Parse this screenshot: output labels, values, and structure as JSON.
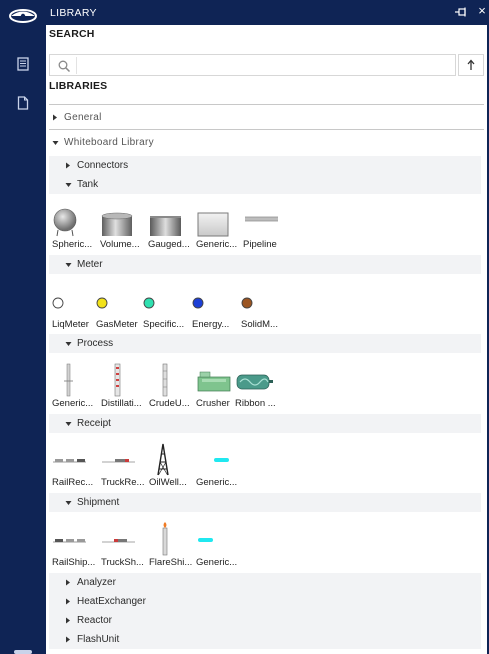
{
  "window": {
    "title": "LIBRARY",
    "close_glyph": "×"
  },
  "search": {
    "heading": "SEARCH",
    "placeholder": "",
    "value": ""
  },
  "libraries_heading": "LIBRARIES",
  "groups": {
    "general": {
      "label": "General",
      "expanded": false
    },
    "whiteboard": {
      "label": "Whiteboard Library",
      "expanded": true
    }
  },
  "categories": {
    "connectors": {
      "label": "Connectors",
      "expanded": false
    },
    "tank": {
      "label": "Tank",
      "expanded": true,
      "items": [
        {
          "label": "Spheric...",
          "icon": "spherical-tank-icon"
        },
        {
          "label": "Volume...",
          "icon": "volume-tank-icon"
        },
        {
          "label": "Gauged...",
          "icon": "gauged-tank-icon"
        },
        {
          "label": "Generic...",
          "icon": "generic-tank-icon"
        },
        {
          "label": "Pipeline",
          "icon": "pipeline-icon"
        }
      ]
    },
    "meter": {
      "label": "Meter",
      "expanded": true,
      "items": [
        {
          "label": "LiqMeter",
          "icon": "liq-meter-icon",
          "color": "#ffffff"
        },
        {
          "label": "GasMeter",
          "icon": "gas-meter-icon",
          "color": "#f2e21a"
        },
        {
          "label": "Specific...",
          "icon": "specific-meter-icon",
          "color": "#2fe0b0"
        },
        {
          "label": "Energy...",
          "icon": "energy-meter-icon",
          "color": "#1c3fd6"
        },
        {
          "label": "SolidM...",
          "icon": "solid-meter-icon",
          "color": "#9b5522"
        }
      ]
    },
    "process": {
      "label": "Process",
      "expanded": true,
      "items": [
        {
          "label": "Generic...",
          "icon": "generic-process-icon"
        },
        {
          "label": "Distillati...",
          "icon": "distillation-column-icon"
        },
        {
          "label": "CrudeU...",
          "icon": "crude-unit-icon"
        },
        {
          "label": "Crusher",
          "icon": "crusher-icon"
        },
        {
          "label": "Ribbon ...",
          "icon": "ribbon-blender-icon"
        }
      ]
    },
    "receipt": {
      "label": "Receipt",
      "expanded": true,
      "items": [
        {
          "label": "RailRec...",
          "icon": "rail-receipt-icon"
        },
        {
          "label": "TruckRe...",
          "icon": "truck-receipt-icon"
        },
        {
          "label": "OilWell...",
          "icon": "oil-well-icon"
        },
        {
          "label": "Generic...",
          "icon": "generic-receipt-icon"
        }
      ]
    },
    "shipment": {
      "label": "Shipment",
      "expanded": true,
      "items": [
        {
          "label": "RailShip...",
          "icon": "rail-shipment-icon"
        },
        {
          "label": "TruckSh...",
          "icon": "truck-shipment-icon"
        },
        {
          "label": "FlareShi...",
          "icon": "flare-shipment-icon"
        },
        {
          "label": "Generic...",
          "icon": "generic-shipment-icon"
        }
      ]
    },
    "analyzer": {
      "label": "Analyzer",
      "expanded": false
    },
    "heat_exchanger": {
      "label": "HeatExchanger",
      "expanded": false
    },
    "reactor": {
      "label": "Reactor",
      "expanded": false
    },
    "flash_unit": {
      "label": "FlashUnit",
      "expanded": false
    }
  },
  "colors": {
    "rail": "#0f2455",
    "row_shade": "#f2f3f5",
    "cyan_connector": "#20e8f0",
    "crusher_green": "#7fc48e",
    "ribbon_teal": "#4a9a8a"
  }
}
